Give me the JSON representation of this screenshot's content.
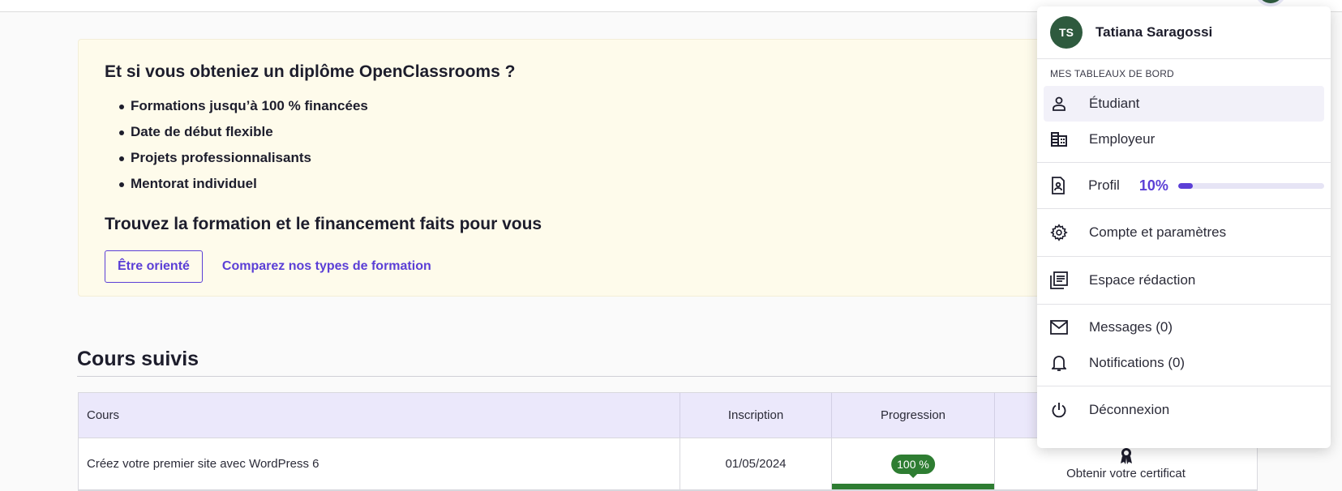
{
  "promo": {
    "title": "Et si vous obteniez un diplôme OpenClassrooms ?",
    "bullets": [
      "Formations jusqu’à 100 % financées",
      "Date de début flexible",
      "Projets professionnalisants",
      "Mentorat individuel"
    ],
    "subtitle": "Trouvez la formation et le financement faits pour vous",
    "button_label": "Être orienté",
    "link_label": "Comparez nos types de formation"
  },
  "courses": {
    "section_title": "Cours suivis",
    "columns": [
      "Cours",
      "Inscription",
      "Progression",
      ""
    ],
    "rows": [
      {
        "course": "Créez votre premier site avec WordPress 6",
        "inscription": "01/05/2024",
        "progress_label": "100 %",
        "progress_fraction": 1.0,
        "certificate_label": "Obtenir votre certificat"
      }
    ]
  },
  "user_menu": {
    "initials": "TS",
    "name": "Tatiana Saragossi",
    "section_label": "MES TABLEAUX DE BORD",
    "items": {
      "student": "Étudiant",
      "employer": "Employeur",
      "profile": "Profil",
      "account": "Compte et paramètres",
      "editorial": "Espace rédaction",
      "messages": "Messages (0)",
      "notifications": "Notifications (0)",
      "logout": "Déconnexion"
    },
    "profile_completion_label": "10%",
    "profile_completion_fraction": 0.1
  },
  "colors": {
    "accent": "#5b3fd6",
    "success": "#2e7d32",
    "avatar_bg": "#2e5a3e",
    "promo_bg": "#fefbeb",
    "table_header_bg": "#ebe8fb"
  }
}
